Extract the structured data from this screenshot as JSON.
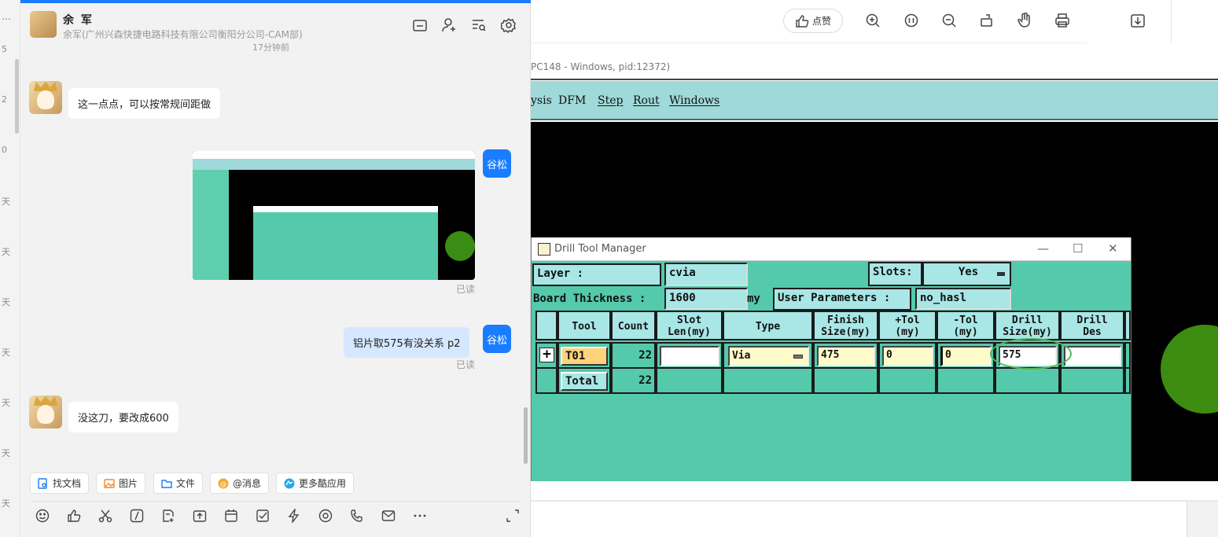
{
  "left_strip": {
    "more": "…",
    "labels": [
      "5",
      "2",
      "0",
      "天",
      "天",
      "天",
      "天",
      "天",
      "天",
      "天"
    ]
  },
  "chat": {
    "header": {
      "name": "余 军",
      "subtitle": "余军(广州兴森快捷电路科技有限公司衡阳分公司-CAM部)"
    },
    "time_note": "17分钟前",
    "messages": [
      {
        "side": "left",
        "text": "这一点点，可以按常规间距做"
      },
      {
        "side": "right",
        "type": "image",
        "sender": "谷松",
        "status": "已读"
      },
      {
        "side": "right",
        "text": "铝片取575有没关系 p2",
        "sender": "谷松",
        "status": "已读"
      },
      {
        "side": "left",
        "text": "没这刀，要改成600"
      }
    ],
    "chips": [
      "找文档",
      "图片",
      "文件",
      "@消息",
      "更多酷应用"
    ],
    "colors": {
      "accent": "#1a7cff",
      "bubble_self": "#d6e8ff"
    }
  },
  "viewer": {
    "like_label": "点赞",
    "window_title": "PC148 - Windows, pid:12372)",
    "menu": [
      "ysis",
      "DFM",
      "Step",
      "Rout",
      "Windows"
    ]
  },
  "drill_tool_manager": {
    "title": "Drill Tool Manager",
    "layer_label": "Layer            :",
    "layer_value": "cvia",
    "slots_label": "Slots:",
    "slots_value": "Yes",
    "board_thickness_label": "Board Thickness :",
    "board_thickness_value": "1600",
    "board_thickness_unit": "my",
    "user_params_label": "User Parameters :",
    "user_params_value": "no_hasl",
    "columns": [
      "Tool",
      "Count",
      "Slot\nLen(my)",
      "Type",
      "Finish\nSize(my)",
      "+Tol\n(my)",
      "-Tol\n(my)",
      "Drill\nSize(my)",
      "Drill\nDes"
    ],
    "rows": [
      {
        "tool": "T01",
        "count": "22",
        "slot_len": "",
        "type": "Via",
        "finish": "475",
        "plus_tol": "0",
        "minus_tol": "0",
        "drill_size": "575",
        "drill_des": ""
      }
    ],
    "total": {
      "label": "Total",
      "count": "22"
    },
    "colors": {
      "bg": "#55c9ab",
      "field": "#a9e6e6",
      "tool_tag": "#fdd27a"
    }
  }
}
